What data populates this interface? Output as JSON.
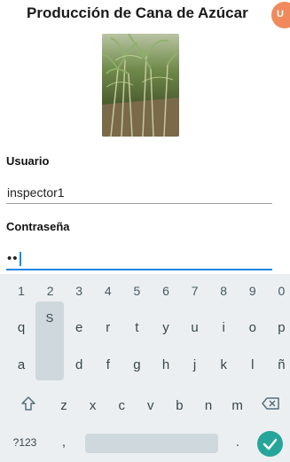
{
  "header": {
    "title": "Producción de Cana de Azúcar",
    "badge_text": "U"
  },
  "form": {
    "user_label": "Usuario",
    "user_value": "inspector1",
    "password_label": "Contraseña",
    "password_value": "••"
  },
  "keyboard": {
    "number_row": [
      "1",
      "2",
      "3",
      "4",
      "5",
      "6",
      "7",
      "8",
      "9",
      "0"
    ],
    "row1": [
      "q",
      "w",
      "e",
      "r",
      "t",
      "y",
      "u",
      "i",
      "o",
      "p"
    ],
    "row2": [
      "a",
      "s",
      "d",
      "f",
      "g",
      "h",
      "j",
      "k",
      "l",
      "ñ"
    ],
    "row3": [
      "z",
      "x",
      "c",
      "v",
      "b",
      "n",
      "m"
    ],
    "symbols_label": "?123",
    "comma": ",",
    "period": ".",
    "pressed_key": "S",
    "accent_color": "#26a69a",
    "field_focus_color": "#1e88e5"
  }
}
